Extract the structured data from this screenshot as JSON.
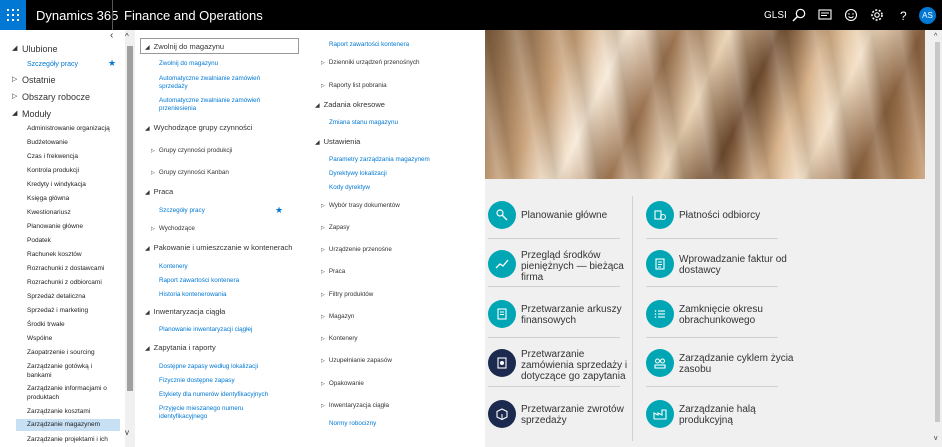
{
  "topbar": {
    "brand": "Dynamics 365",
    "app_name": "Finance and Operations",
    "company": "GLSI",
    "avatar_initials": "AS",
    "icons": [
      "search-icon",
      "message-icon",
      "smiley-icon",
      "gear-icon",
      "help-icon"
    ]
  },
  "leftnav": {
    "sections": {
      "favorites": "Ulubione",
      "recent": "Ostatnie",
      "workspaces": "Obszary robocze",
      "modules": "Moduły"
    },
    "favorite_item": "Szczegóły pracy",
    "modules": [
      "Administrowanie organizacją",
      "Budżetowanie",
      "Czas i frekwencja",
      "Kontrola produkcji",
      "Kredyty i windykacja",
      "Księga główna",
      "Kwestionariusz",
      "Planowanie główne",
      "Podatek",
      "Rachunek kosztów",
      "Rozrachunki z dostawcami",
      "Rozrachunki z odbiorcami",
      "Sprzedaż detaliczna",
      "Sprzedaż i marketing",
      "Środki trwałe",
      "Wspólne",
      "Zaopatrzenie i sourcing",
      "Zarządzanie gotówką i bankami",
      "Zarządzanie informacjami o produktach",
      "Zarządzanie kosztami",
      "Zarządzanie magazynem",
      "Zarządzanie projektami i ich"
    ]
  },
  "flyout": {
    "col1": {
      "h1": "Zwolnij do magazynu",
      "h1_links": [
        "Zwolnij do magazynu",
        "Automatyczne zwalnianie zamówień sprzedaży",
        "Automatyczne zwalnianie zamówień przeniesienia"
      ],
      "h2": "Wychodzące grupy czynności",
      "h2_subs": [
        "Grupy czynności produkcji",
        "Grupy czynności Kanban"
      ],
      "h3": "Praca",
      "h3_link": "Szczegóły pracy",
      "h3_sub": "Wychodzące",
      "h4": "Pakowanie i umieszczanie w kontenerach",
      "h4_links": [
        "Kontenery",
        "Raport zawartości kontenera",
        "Historia kontenerowania"
      ],
      "h5": "Inwentaryzacja ciągła",
      "h5_link": "Planowanie inwentaryzacji ciągłej",
      "h6": "Zapytania i raporty",
      "h6_links": [
        "Dostępne zapasy według lokalizacji",
        "Fizycznie dostępne zapasy",
        "Etykiety dla numerów identyfikacyjnych",
        "Przyjęcie mieszanego numeru identyfikacyjnego"
      ]
    },
    "col2": {
      "top_link": "Raport zawartości kontenera",
      "subs_a": [
        "Dzienniki urządzeń przenośnych",
        "Raporty list pobrania"
      ],
      "h1": "Zadania okresowe",
      "h1_link": "Zmiana stanu magazynu",
      "h2": "Ustawienia",
      "h2_links": [
        "Parametry zarządzania magazynem",
        "Dyrektywy lokalizacji",
        "Kody dyrektyw"
      ],
      "subs_b": [
        "Wybór trasy dokumentów",
        "Zapasy",
        "Urządzenie przenośne",
        "Praca",
        "Filtry produktów",
        "Magazyn",
        "Kontenery",
        "Uzupełnianie zapasów",
        "Opakowanie",
        "Inwentaryzacja ciągła"
      ],
      "bottom_link": "Normy robocizny"
    }
  },
  "tiles": {
    "left": [
      {
        "label": "Planowanie główne",
        "color": "#00a6b4"
      },
      {
        "label": "Przegląd środków pieniężnych — bieżąca firma",
        "color": "#00a6b4"
      },
      {
        "label": "Przetwarzanie arkuszy finansowych",
        "color": "#00a6b4"
      },
      {
        "label": "Przetwarzanie zamówienia sprzedaży i dotyczące go zapytania",
        "color": "#1b2a4e"
      },
      {
        "label": "Przetwarzanie zwrotów sprzedaży",
        "color": "#1b2a4e"
      }
    ],
    "right": [
      {
        "label": "Płatności odbiorcy",
        "color": "#00a6b4"
      },
      {
        "label": "Wprowadzanie faktur od dostawcy",
        "color": "#00a6b4"
      },
      {
        "label": "Zamknięcie okresu obrachunkowego",
        "color": "#00a6b4"
      },
      {
        "label": "Zarządzanie cyklem życia zasobu",
        "color": "#00a6b4"
      },
      {
        "label": "Zarządzanie halą produkcyjną",
        "color": "#00a6b4"
      }
    ]
  }
}
